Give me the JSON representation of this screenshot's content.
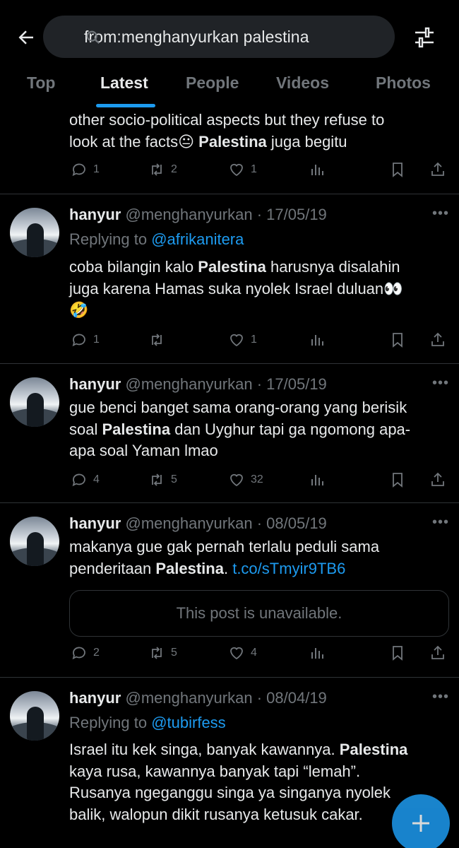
{
  "search": {
    "query": "from:menghanyurkan palestina"
  },
  "tabs": [
    "Top",
    "Latest",
    "People",
    "Videos",
    "Photos"
  ],
  "colors": {
    "accent": "#1d9bf0",
    "muted": "#71767b",
    "background": "#000000"
  },
  "tweets": [
    {
      "text_line1": "other socio-political aspects but they refuse to",
      "text_line2_pre": "look at the facts",
      "emoji": "😐",
      "bold": "Palestina",
      "text_line2_post": "juga begitu",
      "replies": "1",
      "retweets": "2",
      "likes": "1"
    },
    {
      "name": "hanyur",
      "handle": "@menghanyurkan",
      "date": "· 17/05/19",
      "replying_prefix": "Replying to",
      "replying_to": "@afrikanitera",
      "pre": "coba bilangin kalo",
      "bold": "Palestina",
      "line1_post": "harusnya disalahin",
      "line2": "juga karena Hamas suka nyolek Israel duluan",
      "emoji1": "👀",
      "emoji2": "🤣",
      "replies": "1",
      "retweets": "",
      "likes": "1"
    },
    {
      "name": "hanyur",
      "handle": "@menghanyurkan",
      "date": "· 17/05/19",
      "line1": "gue benci banget sama orang-orang yang berisik",
      "line2_pre": "soal",
      "bold": "Palestina",
      "line2_post": "dan Uyghur tapi ga ngomong apa-",
      "line3": "apa soal Yaman lmao",
      "replies": "4",
      "retweets": "5",
      "likes": "32"
    },
    {
      "name": "hanyur",
      "handle": "@menghanyurkan",
      "date": "· 08/05/19",
      "line1": "makanya gue gak pernah terlalu peduli sama",
      "line2_pre": "penderitaan",
      "bold": "Palestina",
      "line2_post": ".",
      "link": "t.co/sTmyir9TB6",
      "quote": "This post is unavailable.",
      "replies": "2",
      "retweets": "5",
      "likes": "4"
    },
    {
      "name": "hanyur",
      "handle": "@menghanyurkan",
      "date": "· 08/04/19",
      "replying_prefix": "Replying to",
      "replying_to": "@tubirfess",
      "line1_pre": "Israel itu kek singa, banyak kawannya.",
      "bold": "Palestina",
      "line2": "kaya rusa, kawannya banyak tapi “lemah”.",
      "line3": "Rusanya ngeganggu singa ya singanya nyolek",
      "line4": "balik, walopun dikit rusanya ketusuk cakar."
    }
  ]
}
